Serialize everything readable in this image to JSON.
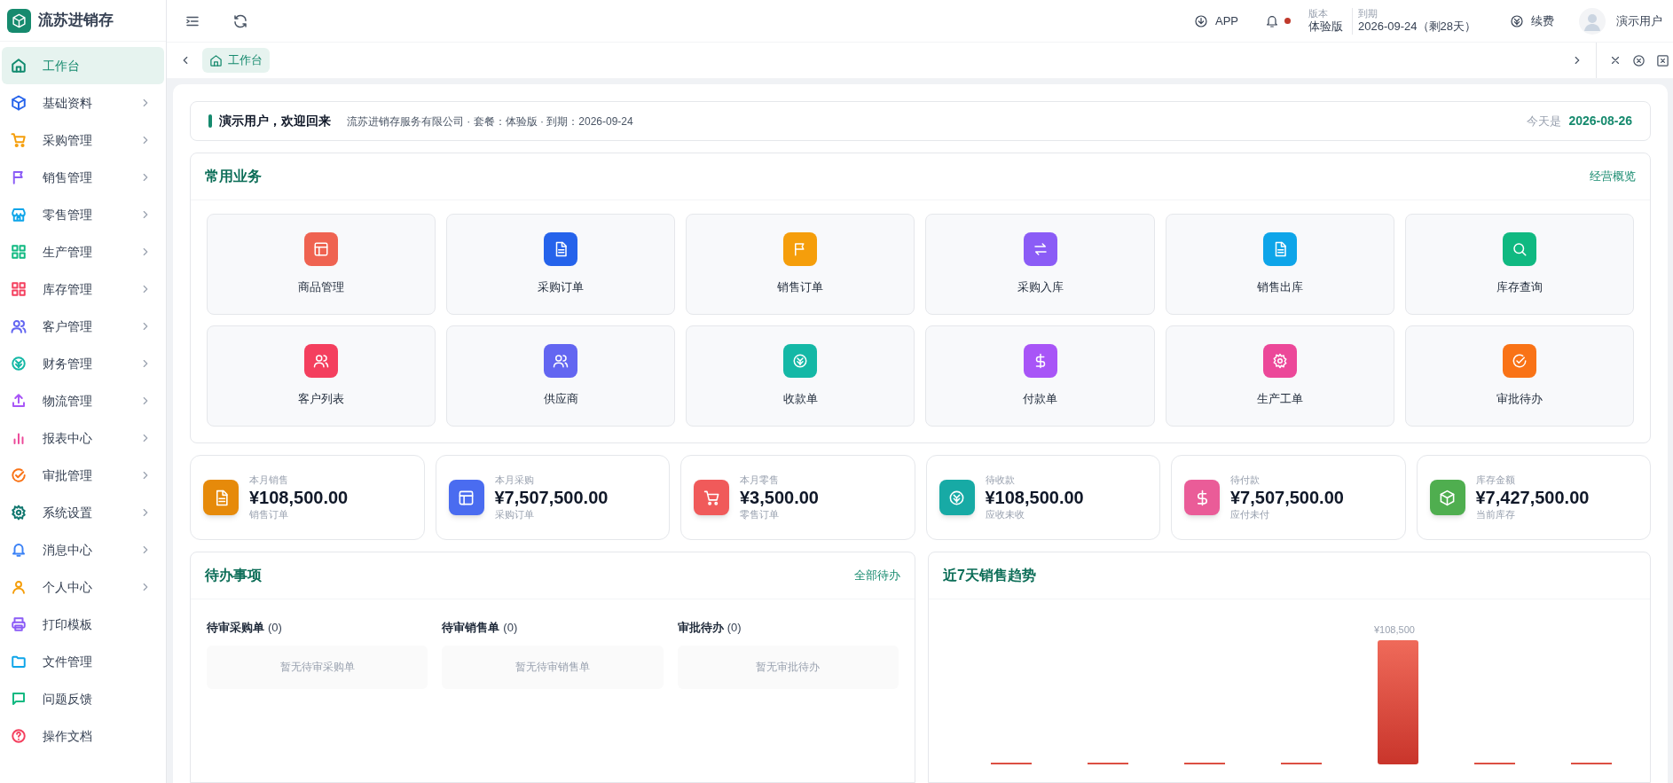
{
  "app": {
    "title": "流苏进销存"
  },
  "sidebar": {
    "items": [
      {
        "label": "工作台",
        "selected": true,
        "expandable": false,
        "color": "#0f8a6e"
      },
      {
        "label": "基础资料",
        "selected": false,
        "expandable": true,
        "color": "#2563eb"
      },
      {
        "label": "采购管理",
        "selected": false,
        "expandable": true,
        "color": "#f59e0b"
      },
      {
        "label": "销售管理",
        "selected": false,
        "expandable": true,
        "color": "#8b5cf6"
      },
      {
        "label": "零售管理",
        "selected": false,
        "expandable": true,
        "color": "#0ea5e9"
      },
      {
        "label": "生产管理",
        "selected": false,
        "expandable": true,
        "color": "#10b981"
      },
      {
        "label": "库存管理",
        "selected": false,
        "expandable": true,
        "color": "#f43f5e"
      },
      {
        "label": "客户管理",
        "selected": false,
        "expandable": true,
        "color": "#6366f1"
      },
      {
        "label": "财务管理",
        "selected": false,
        "expandable": true,
        "color": "#14b8a6"
      },
      {
        "label": "物流管理",
        "selected": false,
        "expandable": true,
        "color": "#a855f7"
      },
      {
        "label": "报表中心",
        "selected": false,
        "expandable": true,
        "color": "#ec4899"
      },
      {
        "label": "审批管理",
        "selected": false,
        "expandable": true,
        "color": "#f97316"
      },
      {
        "label": "系统设置",
        "selected": false,
        "expandable": true,
        "color": "#0f766e"
      },
      {
        "label": "消息中心",
        "selected": false,
        "expandable": true,
        "color": "#3b82f6"
      },
      {
        "label": "个人中心",
        "selected": false,
        "expandable": true,
        "color": "#f59e0b"
      },
      {
        "label": "打印模板",
        "selected": false,
        "expandable": false,
        "color": "#8b5cf6"
      },
      {
        "label": "文件管理",
        "selected": false,
        "expandable": false,
        "color": "#0ea5e9"
      },
      {
        "label": "问题反馈",
        "selected": false,
        "expandable": false,
        "color": "#10b981"
      },
      {
        "label": "操作文档",
        "selected": false,
        "expandable": false,
        "color": "#f43f5e"
      }
    ]
  },
  "topbar": {
    "app_button": "APP",
    "notifications_unread": true,
    "edition_label": "版本",
    "edition": "体验版",
    "expiry_label": "到期",
    "expiry": "2026-09-24（剩28天）",
    "renew": "续费",
    "user": "演示用户"
  },
  "tabs": [
    {
      "label": "工作台",
      "selected": true
    }
  ],
  "welcome": {
    "greeting": "演示用户，欢迎回来",
    "info": "流苏进销存服务有限公司 · 套餐：体验版 · 到期：2026-09-24",
    "today_label": "今天是",
    "today": "2026-08-26"
  },
  "shortcuts": {
    "title": "常用业务",
    "link": "经营概览",
    "items": [
      {
        "label": "商品管理",
        "color": "#ef6351"
      },
      {
        "label": "采购订单",
        "color": "#2563eb"
      },
      {
        "label": "销售订单",
        "color": "#f59e0b"
      },
      {
        "label": "采购入库",
        "color": "#8b5cf6"
      },
      {
        "label": "销售出库",
        "color": "#0ea5e9"
      },
      {
        "label": "库存查询",
        "color": "#10b981"
      },
      {
        "label": "客户列表",
        "color": "#f43f5e"
      },
      {
        "label": "供应商",
        "color": "#6366f1"
      },
      {
        "label": "收款单",
        "color": "#14b8a6"
      },
      {
        "label": "付款单",
        "color": "#a855f7"
      },
      {
        "label": "生产工单",
        "color": "#ec4899"
      },
      {
        "label": "审批待办",
        "color": "#f97316"
      }
    ]
  },
  "stats": [
    {
      "label": "本月销售",
      "value": "¥108,500.00",
      "note": "销售订单",
      "color": "#e68a0a"
    },
    {
      "label": "本月采购",
      "value": "¥7,507,500.00",
      "note": "采购订单",
      "color": "#4a6cf0"
    },
    {
      "label": "本月零售",
      "value": "¥3,500.00",
      "note": "零售订单",
      "color": "#f05a5a"
    },
    {
      "label": "待收款",
      "value": "¥108,500.00",
      "note": "应收未收",
      "color": "#17aaa5"
    },
    {
      "label": "待付款",
      "value": "¥7,507,500.00",
      "note": "应付未付",
      "color": "#ea5c98"
    },
    {
      "label": "库存金额",
      "value": "¥7,427,500.00",
      "note": "当前库存",
      "color": "#4fae4f"
    }
  ],
  "todo": {
    "title": "待办事项",
    "link": "全部待办",
    "columns": [
      {
        "title": "待审采购单",
        "count": "(0)",
        "empty": "暂无待审采购单"
      },
      {
        "title": "待审销售单",
        "count": "(0)",
        "empty": "暂无待审销售单"
      },
      {
        "title": "审批待办",
        "count": "(0)",
        "empty": "暂无审批待办"
      }
    ]
  },
  "trend": {
    "title": "近7天销售趋势",
    "peak_label": "¥108,500"
  }
}
